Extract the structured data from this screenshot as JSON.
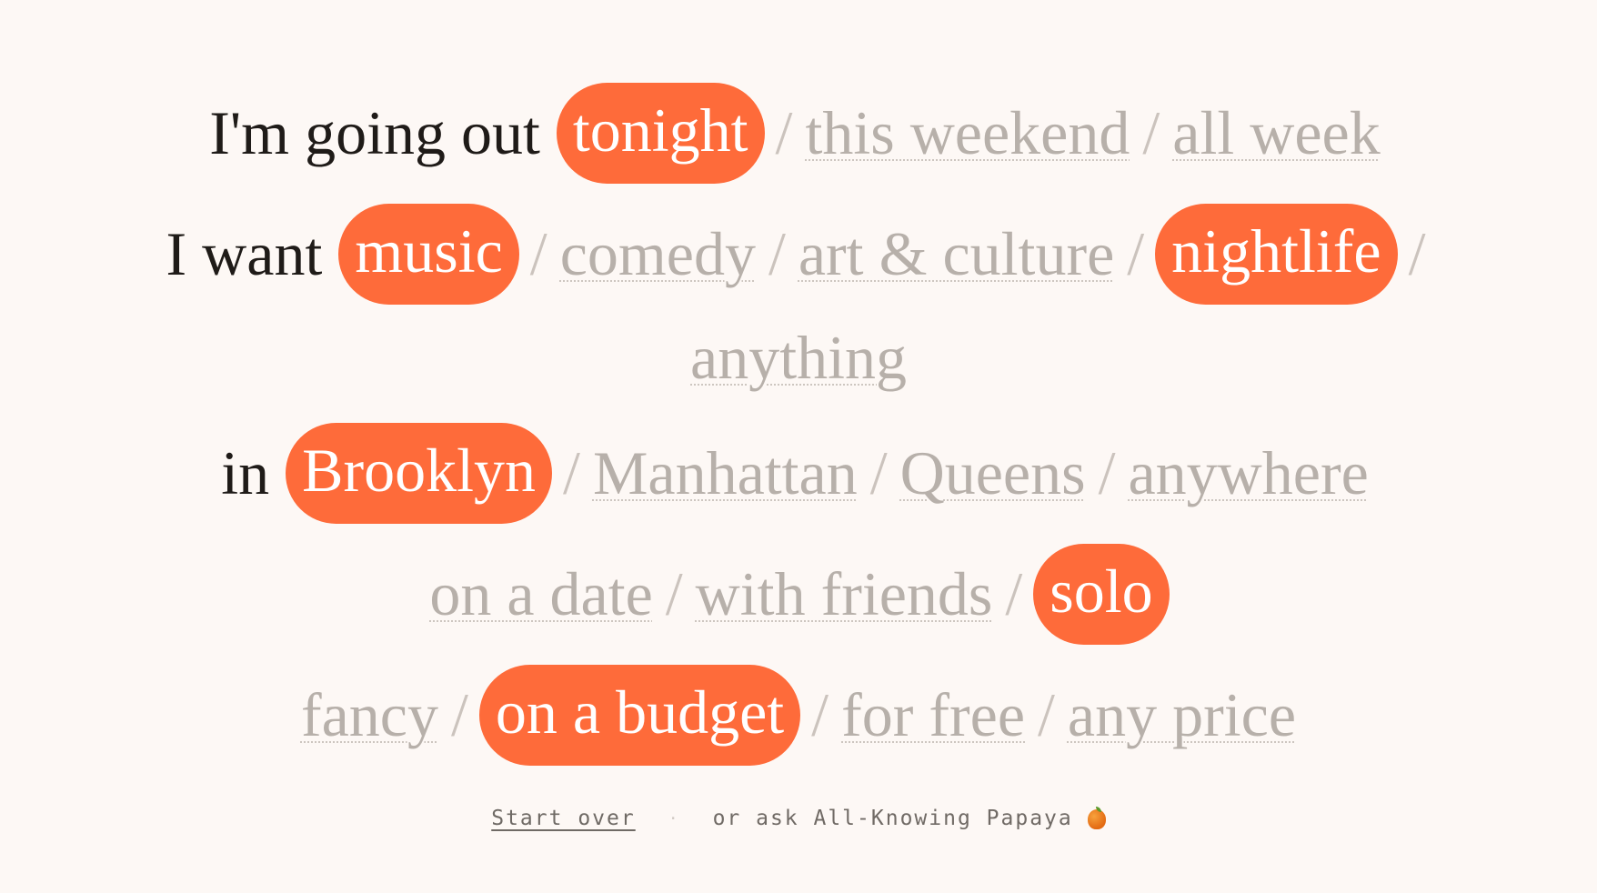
{
  "lines": [
    {
      "lead": "I'm going out",
      "options": [
        {
          "label": "tonight",
          "selected": true
        },
        {
          "label": "this weekend",
          "selected": false
        },
        {
          "label": "all week",
          "selected": false
        }
      ]
    },
    {
      "lead": "I want",
      "options": [
        {
          "label": "music",
          "selected": true
        },
        {
          "label": "comedy",
          "selected": false
        },
        {
          "label": "art & culture",
          "selected": false
        },
        {
          "label": "nightlife",
          "selected": true
        },
        {
          "label": "anything",
          "selected": false
        }
      ]
    },
    {
      "lead": "in",
      "options": [
        {
          "label": "Brooklyn",
          "selected": true
        },
        {
          "label": "Manhattan",
          "selected": false
        },
        {
          "label": "Queens",
          "selected": false
        },
        {
          "label": "anywhere",
          "selected": false
        }
      ]
    },
    {
      "lead": "",
      "options": [
        {
          "label": "on a date",
          "selected": false
        },
        {
          "label": "with friends",
          "selected": false
        },
        {
          "label": "solo",
          "selected": true
        }
      ]
    },
    {
      "lead": "",
      "options": [
        {
          "label": "fancy",
          "selected": false
        },
        {
          "label": "on a budget",
          "selected": true
        },
        {
          "label": "for free",
          "selected": false
        },
        {
          "label": "any price",
          "selected": false
        }
      ]
    }
  ],
  "separator": "/",
  "footer": {
    "start_over": "Start over",
    "dot": "·",
    "ask": "or ask All-Knowing Papaya",
    "icon": "papaya-icon"
  },
  "colors": {
    "accent": "#fe6b3a",
    "lead_text": "#1f1b18",
    "option_text": "#b7b0aa",
    "background": "#fdf8f5"
  }
}
